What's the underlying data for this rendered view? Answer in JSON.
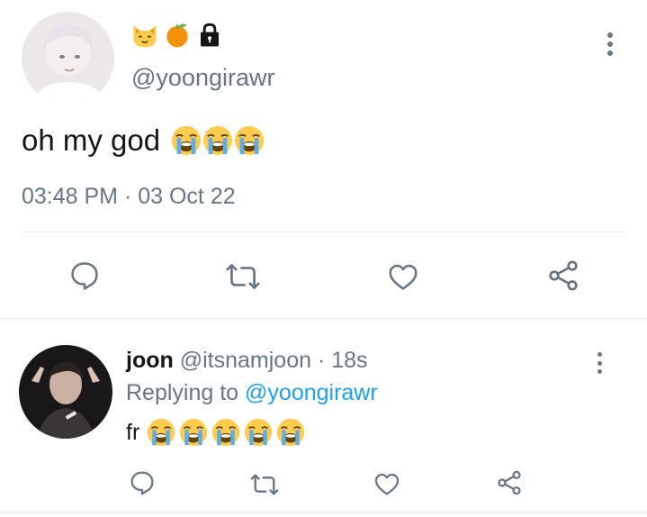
{
  "main_tweet": {
    "name_emojis": [
      "cat-face",
      "tangerine",
      "lock"
    ],
    "handle": "@yoongirawr",
    "text": "oh my god",
    "text_emojis": [
      "loudly-crying-face",
      "loudly-crying-face",
      "loudly-crying-face"
    ],
    "timestamp": "03:48 PM · 03 Oct 22",
    "actions": [
      "reply-icon",
      "retweet-icon",
      "like-icon",
      "share-icon"
    ]
  },
  "reply_tweet": {
    "name": "joon",
    "handle": "@itsnamjoon",
    "time": "· 18s",
    "replying_prefix": "Replying to",
    "replying_handle": "@yoongirawr",
    "text": "fr",
    "text_emojis": [
      "loudly-crying-face",
      "loudly-crying-face",
      "loudly-crying-face",
      "loudly-crying-face",
      "loudly-crying-face"
    ],
    "actions": [
      "reply-icon",
      "retweet-icon",
      "like-icon",
      "share-icon"
    ]
  },
  "colors": {
    "secondary_text": "#657786",
    "link": "#1da1f2",
    "divider": "#e1e8ed",
    "icon": "#657786"
  }
}
